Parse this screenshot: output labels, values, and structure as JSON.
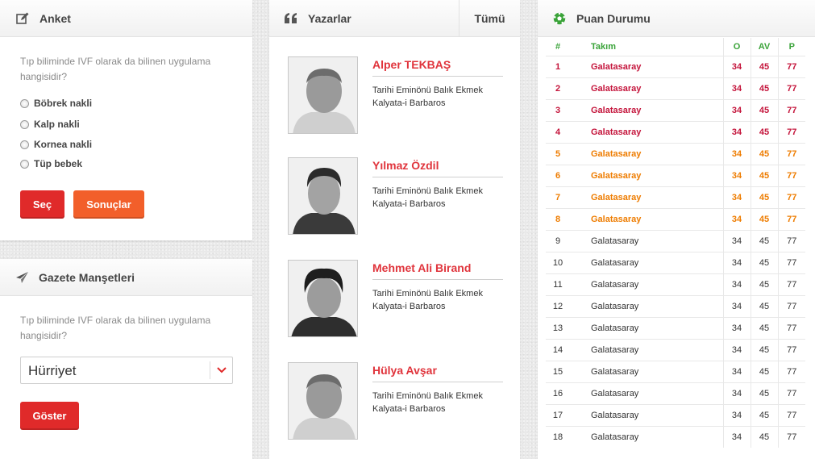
{
  "anket": {
    "title": "Anket",
    "icon": "edit-icon",
    "question": "Tıp biliminde IVF olarak da bilinen uygulama hangisidir?",
    "options": [
      "Böbrek nakli",
      "Kalp nakli",
      "Kornea nakli",
      "Tüp bebek"
    ],
    "vote_label": "Seç",
    "results_label": "Sonuçlar"
  },
  "gazete": {
    "title": "Gazete Manşetleri",
    "icon": "paper-plane-icon",
    "question": "Tıp biliminde IVF olarak da bilinen uygulama hangisidir?",
    "selected_newspaper": "Hürriyet",
    "show_label": "Göster"
  },
  "yazarlar": {
    "title": "Yazarlar",
    "icon": "quote-icon",
    "all_label": "Tümü",
    "authors": [
      {
        "name": "Alper TEKBAŞ",
        "article": "Tarihi Eminönü Balık Ekmek Kalyata-i Barbaros"
      },
      {
        "name": "Yılmaz Özdil",
        "article": "Tarihi Eminönü Balık Ekmek Kalyata-i Barbaros"
      },
      {
        "name": "Mehmet Ali Birand",
        "article": "Tarihi Eminönü Balık Ekmek Kalyata-i Barbaros"
      },
      {
        "name": "Hülya Avşar",
        "article": "Tarihi Eminönü Balık Ekmek Kalyata-i Barbaros"
      }
    ]
  },
  "puan": {
    "title": "Puan Durumu",
    "icon": "soccer-ball-icon",
    "headers": {
      "rank": "#",
      "team": "Takım",
      "played": "O",
      "average": "AV",
      "points": "P"
    },
    "rows": [
      {
        "rank": "1",
        "team": "Galatasaray",
        "played": "34",
        "average": "45",
        "points": "77",
        "zone": "red"
      },
      {
        "rank": "2",
        "team": "Galatasaray",
        "played": "34",
        "average": "45",
        "points": "77",
        "zone": "red"
      },
      {
        "rank": "3",
        "team": "Galatasaray",
        "played": "34",
        "average": "45",
        "points": "77",
        "zone": "red"
      },
      {
        "rank": "4",
        "team": "Galatasaray",
        "played": "34",
        "average": "45",
        "points": "77",
        "zone": "red"
      },
      {
        "rank": "5",
        "team": "Galatasaray",
        "played": "34",
        "average": "45",
        "points": "77",
        "zone": "orange"
      },
      {
        "rank": "6",
        "team": "Galatasaray",
        "played": "34",
        "average": "45",
        "points": "77",
        "zone": "orange"
      },
      {
        "rank": "7",
        "team": "Galatasaray",
        "played": "34",
        "average": "45",
        "points": "77",
        "zone": "orange"
      },
      {
        "rank": "8",
        "team": "Galatasaray",
        "played": "34",
        "average": "45",
        "points": "77",
        "zone": "orange"
      },
      {
        "rank": "9",
        "team": "Galatasaray",
        "played": "34",
        "average": "45",
        "points": "77",
        "zone": "none"
      },
      {
        "rank": "10",
        "team": "Galatasaray",
        "played": "34",
        "average": "45",
        "points": "77",
        "zone": "none"
      },
      {
        "rank": "11",
        "team": "Galatasaray",
        "played": "34",
        "average": "45",
        "points": "77",
        "zone": "none"
      },
      {
        "rank": "12",
        "team": "Galatasaray",
        "played": "34",
        "average": "45",
        "points": "77",
        "zone": "none"
      },
      {
        "rank": "13",
        "team": "Galatasaray",
        "played": "34",
        "average": "45",
        "points": "77",
        "zone": "none"
      },
      {
        "rank": "14",
        "team": "Galatasaray",
        "played": "34",
        "average": "45",
        "points": "77",
        "zone": "none"
      },
      {
        "rank": "15",
        "team": "Galatasaray",
        "played": "34",
        "average": "45",
        "points": "77",
        "zone": "none"
      },
      {
        "rank": "16",
        "team": "Galatasaray",
        "played": "34",
        "average": "45",
        "points": "77",
        "zone": "none"
      },
      {
        "rank": "17",
        "team": "Galatasaray",
        "played": "34",
        "average": "45",
        "points": "77",
        "zone": "none"
      },
      {
        "rank": "18",
        "team": "Galatasaray",
        "played": "34",
        "average": "45",
        "points": "77",
        "zone": "none"
      }
    ]
  },
  "colors": {
    "accent_red": "#e02a2a",
    "accent_orange": "#f25f2a",
    "author_name": "#e0343c",
    "table_header": "#3aa339",
    "zone_red": "#c4143b",
    "zone_orange": "#ee7c00"
  }
}
